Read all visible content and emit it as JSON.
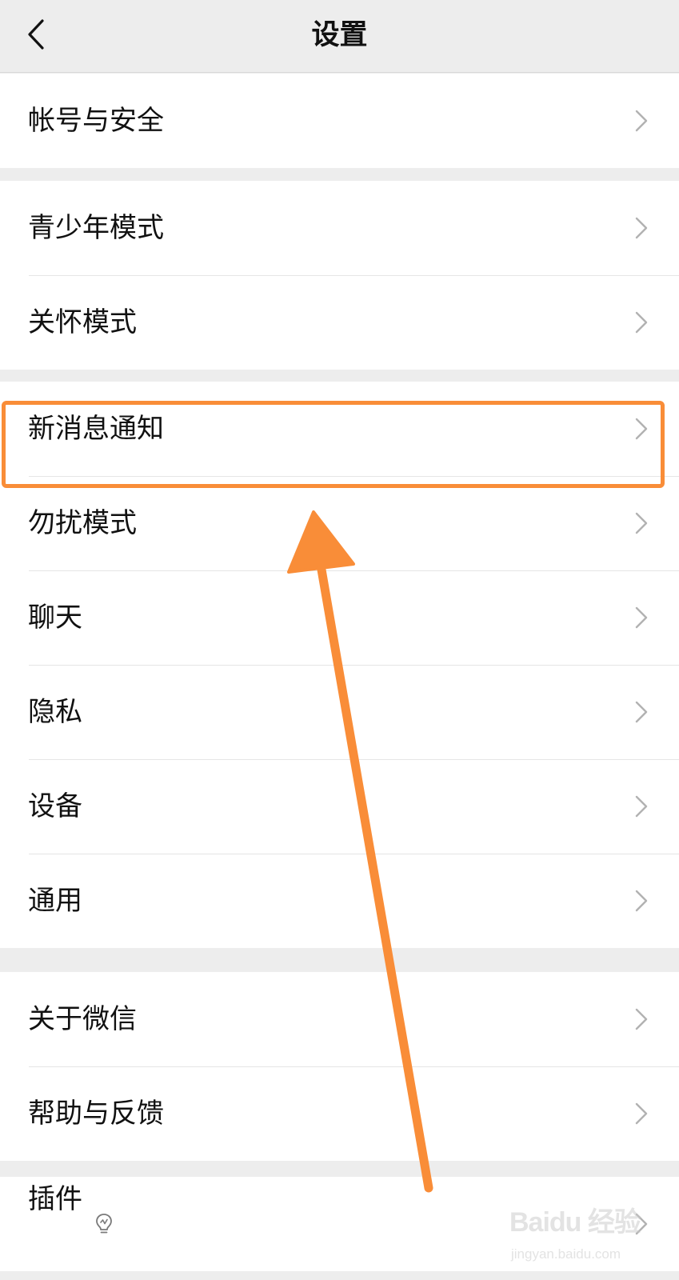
{
  "header": {
    "title": "设置"
  },
  "groups": [
    {
      "items": [
        {
          "label": "帐号与安全"
        }
      ]
    },
    {
      "items": [
        {
          "label": "青少年模式"
        },
        {
          "label": "关怀模式"
        }
      ]
    },
    {
      "items": [
        {
          "label": "新消息通知"
        },
        {
          "label": "勿扰模式"
        },
        {
          "label": "聊天"
        },
        {
          "label": "隐私"
        },
        {
          "label": "设备"
        },
        {
          "label": "通用"
        }
      ]
    },
    {
      "items": [
        {
          "label": "关于微信"
        },
        {
          "label": "帮助与反馈"
        }
      ]
    },
    {
      "items": [
        {
          "label": "插件",
          "icon": "lightbulb-icon"
        }
      ]
    }
  ],
  "annotation": {
    "highlight_color": "#f98d38"
  },
  "watermark": {
    "logo": "Baidu 经验",
    "url": "jingyan.baidu.com"
  }
}
